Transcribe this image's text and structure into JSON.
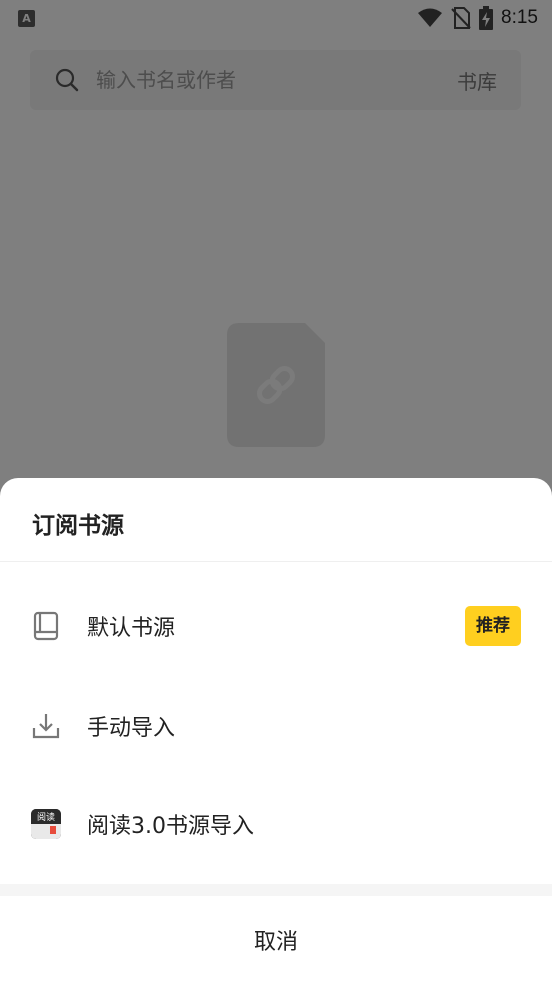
{
  "status_bar": {
    "app_icon_letter": "A",
    "time": "8:15"
  },
  "search": {
    "placeholder": "输入书名或作者",
    "library_label": "书库"
  },
  "sheet": {
    "title": "订阅书源",
    "options": [
      {
        "label": "默认书源",
        "icon": "book-icon",
        "badge": "推荐"
      },
      {
        "label": "手动导入",
        "icon": "download-icon"
      },
      {
        "label": "阅读3.0书源导入",
        "icon": "legado-app-icon",
        "icon_text": "阅读"
      }
    ],
    "cancel_label": "取消"
  },
  "colors": {
    "badge_bg": "#ffcf1f",
    "overlay": "rgba(0,0,0,0.5)"
  }
}
